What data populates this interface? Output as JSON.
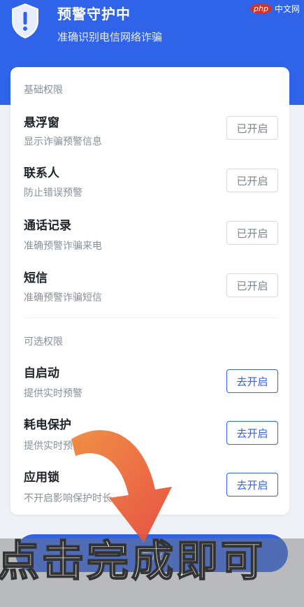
{
  "header": {
    "title": "预警守护中",
    "subtitle": "准确识别电信网络诈骗",
    "watermark": "中文网",
    "watermark_badge": "php"
  },
  "basic": {
    "label": "基础权限",
    "items": [
      {
        "title": "悬浮窗",
        "desc": "显示诈骗预警信息",
        "button": "已开启"
      },
      {
        "title": "联系人",
        "desc": "防止错误预警",
        "button": "已开启"
      },
      {
        "title": "通话记录",
        "desc": "准确预警诈骗来电",
        "button": "已开启"
      },
      {
        "title": "短信",
        "desc": "准确预警诈骗短信",
        "button": "已开启"
      }
    ]
  },
  "optional": {
    "label": "可选权限",
    "items": [
      {
        "title": "自启动",
        "desc": "提供实时预警",
        "button": "去开启"
      },
      {
        "title": "耗电保护",
        "desc": "提供实时预警",
        "button": "去开启"
      },
      {
        "title": "应用锁",
        "desc": "不开启影响保护时长",
        "button": "去开启"
      }
    ]
  },
  "footer": {
    "done_label": "完成",
    "caption": "点击完成即可"
  },
  "colors": {
    "primary": "#2f63e8",
    "arrow": "#ee6a2b"
  }
}
